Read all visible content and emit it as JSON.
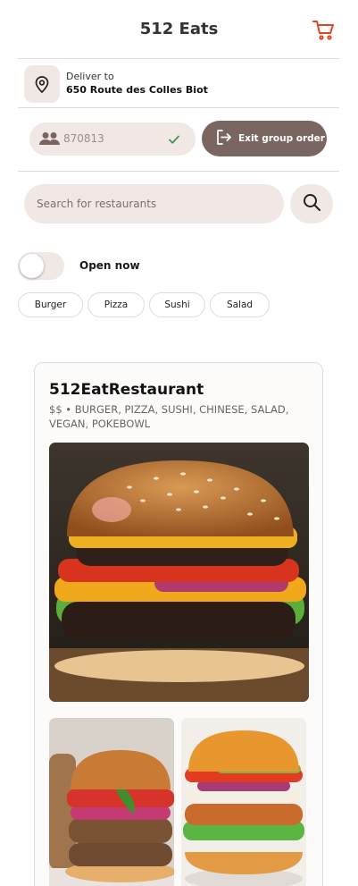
{
  "header": {
    "title": "512 Eats"
  },
  "delivery": {
    "label": "Deliver to",
    "address": "650 Route des Colles Biot"
  },
  "group": {
    "code": "870813",
    "exit_label": "Exit group order"
  },
  "search": {
    "placeholder": "Search for restaurants"
  },
  "filter": {
    "open_now_label": "Open now",
    "open_now_on": false
  },
  "categories": [
    "Burger",
    "Pizza",
    "Sushi",
    "Salad"
  ],
  "restaurant": {
    "name": "512EatRestaurant",
    "meta": "$$ • BURGER, PIZZA, SUSHI, CHINESE, SALAD, VEGAN, POKEBOWL"
  },
  "colors": {
    "accent": "#e0451f",
    "chip_bg": "#f1e8e6",
    "button_dark": "#7a6661",
    "check": "#3a9a4a"
  }
}
